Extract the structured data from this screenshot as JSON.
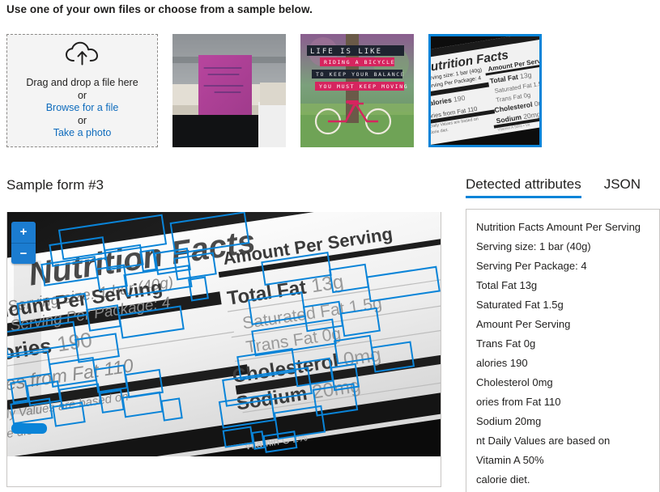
{
  "header": {
    "intro": "Use one of your own files or choose from a sample below."
  },
  "dropzone": {
    "icon": "cloud-upload-icon",
    "line1": "Drag and drop a file here",
    "or1": "or",
    "browse_link": "Browse for a file",
    "or2": "or",
    "photo_link": "Take a photo"
  },
  "samples": [
    {
      "name": "sticky-note-sample",
      "alt": "Purple sticky note on office cubicle",
      "selected": false
    },
    {
      "name": "bicycle-poster-sample",
      "alt": "Life is like riding a bicycle poster",
      "selected": false
    },
    {
      "name": "nutrition-facts-sample",
      "alt": "Nutrition Facts label close-up",
      "selected": true
    }
  ],
  "form": {
    "title": "Sample form #3"
  },
  "viewer": {
    "zoom_in_label": "+",
    "zoom_out_label": "−",
    "zoom_in_icon": "plus-icon",
    "zoom_out_icon": "minus-icon",
    "ocr_box_color": "#0a84d8",
    "selection_color": "#0a84d8"
  },
  "right_panel": {
    "tabs": [
      {
        "label": "Detected attributes",
        "active": true
      },
      {
        "label": "JSON",
        "active": false
      }
    ],
    "attributes": [
      "Nutrition Facts Amount Per Serving",
      "Serving size: 1 bar (40g)",
      "Serving Per Package: 4",
      "Total Fat 13g",
      "Saturated Fat 1.5g",
      "Amount Per Serving",
      "Trans Fat 0g",
      "alories 190",
      "Cholesterol 0mg",
      "ories from Fat 110",
      "Sodium 20mg",
      "nt Daily Values are based on",
      "Vitamin A 50%",
      "calorie diet."
    ]
  },
  "theme": {
    "accent": "#0a84d8",
    "link": "#0f6cbd",
    "text": "#201f1e",
    "border": "#c8c6c4"
  }
}
